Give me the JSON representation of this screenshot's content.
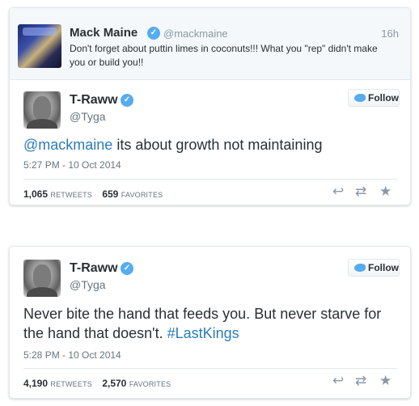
{
  "quoted": {
    "name": "Mack Maine",
    "handle": "@mackmaine",
    "time": "16h",
    "text": "Don't forget about puttin limes in coconuts!!! What you \"rep\" didn't make you or build you!!"
  },
  "tweets": [
    {
      "name": "T-Raww",
      "handle": "@Tyga",
      "follow_label": "Follow",
      "text_link": "@mackmaine",
      "text_main": " its about growth not maintaining",
      "date": "5:27 PM - 10 Oct 2014",
      "retweets_count": "1,065",
      "retweets_label": "RETWEETS",
      "favorites_count": "659",
      "favorites_label": "FAVORITES"
    },
    {
      "name": "T-Raww",
      "handle": "@Tyga",
      "follow_label": "Follow",
      "text_main": "Never bite the hand that feeds you. But never starve for the hand that doesn't. ",
      "text_link": "#LastKings",
      "date": "5:28 PM - 10 Oct 2014",
      "retweets_count": "4,190",
      "retweets_label": "RETWEETS",
      "favorites_count": "2,570",
      "favorites_label": "FAVORITES"
    }
  ],
  "icons": {
    "verified": "✓",
    "reply": "↩",
    "retweet": "⇄",
    "favorite": "★"
  },
  "colors": {
    "link": "#2b7bb9",
    "verified": "#55acee"
  }
}
